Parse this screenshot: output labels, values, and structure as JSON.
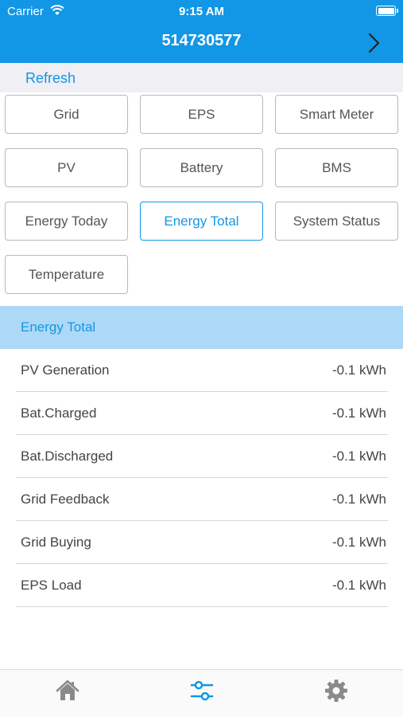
{
  "status_bar": {
    "carrier": "Carrier",
    "time": "9:15 AM"
  },
  "header": {
    "title": "514730577"
  },
  "refresh_label": "Refresh",
  "buttons": [
    {
      "label": "Grid"
    },
    {
      "label": "EPS"
    },
    {
      "label": "Smart Meter"
    },
    {
      "label": "PV"
    },
    {
      "label": "Battery"
    },
    {
      "label": "BMS"
    },
    {
      "label": "Energy Today"
    },
    {
      "label": "Energy Total",
      "active": true
    },
    {
      "label": "System Status"
    },
    {
      "label": "Temperature"
    }
  ],
  "section": {
    "title": "Energy Total",
    "rows": [
      {
        "label": "PV Generation",
        "value": "-0.1 kWh"
      },
      {
        "label": "Bat.Charged",
        "value": "-0.1 kWh"
      },
      {
        "label": "Bat.Discharged",
        "value": "-0.1 kWh"
      },
      {
        "label": "Grid Feedback",
        "value": "-0.1 kWh"
      },
      {
        "label": "Grid Buying",
        "value": "-0.1 kWh"
      },
      {
        "label": "EPS Load",
        "value": "-0.1 kWh"
      }
    ]
  },
  "tab_bar": {
    "tabs": [
      {
        "icon": "home-icon",
        "active": false
      },
      {
        "icon": "sliders-icon",
        "active": true
      },
      {
        "icon": "gear-icon",
        "active": false
      }
    ]
  },
  "colors": {
    "accent": "#1197e6",
    "section_bg": "#aed9f6",
    "tab_inactive": "#8a8a8a"
  }
}
